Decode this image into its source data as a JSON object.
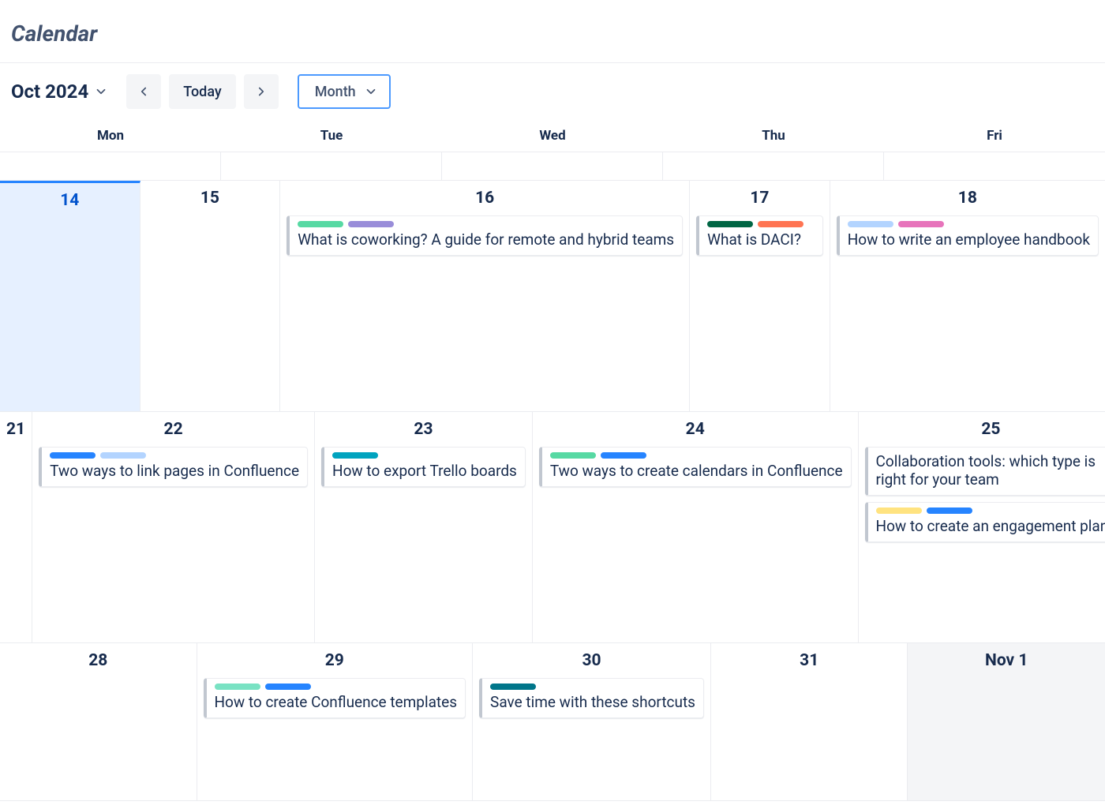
{
  "page": {
    "title": "Calendar"
  },
  "toolbar": {
    "month_label": "Oct 2024",
    "today_label": "Today",
    "view_label": "Month"
  },
  "day_headers": [
    "Mon",
    "Tue",
    "Wed",
    "Thu",
    "Fri"
  ],
  "colors": {
    "green": "#57D9A3",
    "purple": "#998DD9",
    "darkgreen": "#006644",
    "coral": "#FF7452",
    "lightblue": "#B3D4FF",
    "pink": "#E774BB",
    "blue": "#2684FF",
    "teal": "#00A3BF",
    "mint": "#79E2C3",
    "yellow": "#FFE380",
    "darkteal": "#00768A"
  },
  "weeks": [
    {
      "partial": true,
      "days": [
        {
          "label": "",
          "events": []
        },
        {
          "label": "",
          "events": []
        },
        {
          "label": "",
          "events": []
        },
        {
          "label": "",
          "events": []
        },
        {
          "label": "",
          "events": []
        }
      ]
    },
    {
      "days": [
        {
          "label": "14",
          "today": true,
          "events": []
        },
        {
          "label": "15",
          "events": []
        },
        {
          "label": "16",
          "events": [
            {
              "title": "What is coworking? A guide for remote and hybrid teams",
              "tags": [
                "green",
                "purple"
              ]
            }
          ]
        },
        {
          "label": "17",
          "events": [
            {
              "title": "What is DACI?",
              "tags": [
                "darkgreen",
                "coral"
              ]
            }
          ]
        },
        {
          "label": "18",
          "events": [
            {
              "title": "How to write an employee handbook",
              "tags": [
                "lightblue",
                "pink"
              ]
            }
          ]
        }
      ]
    },
    {
      "days": [
        {
          "label": "21",
          "events": []
        },
        {
          "label": "22",
          "events": [
            {
              "title": "Two ways to link pages in Confluence",
              "tags": [
                "blue",
                "lightblue"
              ]
            }
          ]
        },
        {
          "label": "23",
          "events": [
            {
              "title": "How to export Trello boards",
              "tags": [
                "teal"
              ]
            }
          ]
        },
        {
          "label": "24",
          "events": [
            {
              "title": "Two ways to create calendars in Confluence",
              "tags": [
                "green",
                "blue"
              ]
            }
          ]
        },
        {
          "label": "25",
          "events": [
            {
              "title": "Collaboration tools: which type is right for your team",
              "twoline": true,
              "tags": []
            },
            {
              "title": "How to create an engagement plan",
              "tags": [
                "yellow",
                "blue"
              ]
            }
          ]
        }
      ]
    },
    {
      "days": [
        {
          "label": "28",
          "events": []
        },
        {
          "label": "29",
          "events": [
            {
              "title": "How to create Confluence templates",
              "tags": [
                "mint",
                "blue"
              ]
            }
          ]
        },
        {
          "label": "30",
          "events": [
            {
              "title": "Save time with these shortcuts",
              "tags": [
                "darkteal"
              ]
            }
          ]
        },
        {
          "label": "31",
          "events": []
        },
        {
          "label": "Nov 1",
          "out": true,
          "events": []
        }
      ]
    }
  ]
}
